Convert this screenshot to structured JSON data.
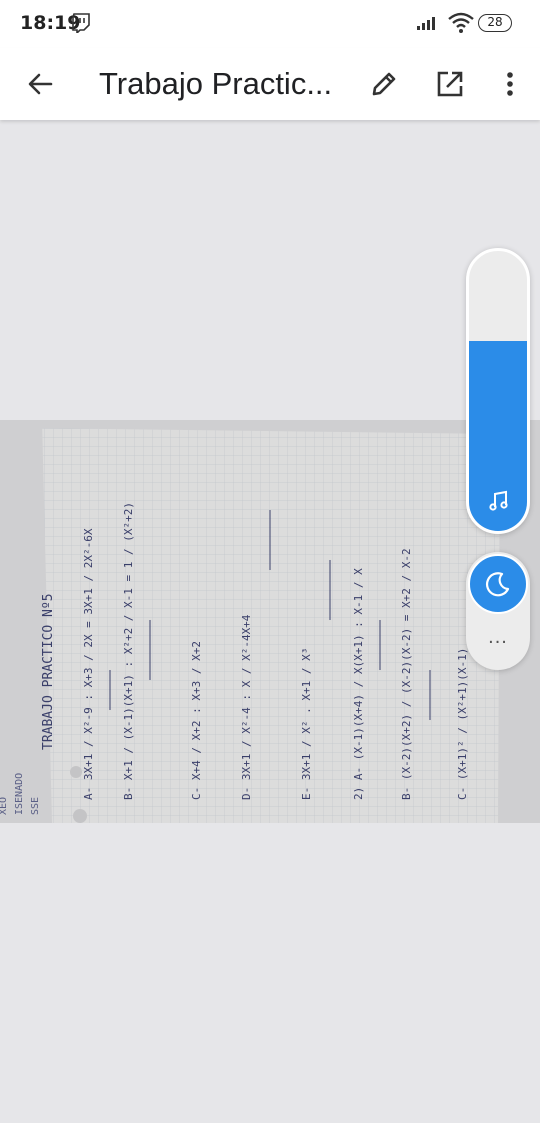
{
  "status_bar": {
    "time": "18:19",
    "battery": "28",
    "icons": [
      "twitch-icon",
      "signal-icon",
      "wifi-icon",
      "battery-icon"
    ]
  },
  "app_bar": {
    "title": "Trabajo Practic...",
    "icons": [
      "back-arrow-icon",
      "pencil-icon",
      "open-in-new-icon",
      "more-vert-icon"
    ]
  },
  "document": {
    "heading": "TRABAJO PRACTICO Nº5",
    "lines": [
      "A- 3X+1 / X²-9 : X+3 / 2X = 3X+1 / 2X²-6X",
      "B- X+1 / (X-1)(X+1) : X²+2 / X-1 = 1 / (X²+2)",
      "C- X+4 / X+2 : X+3 / X+2",
      "D- 3X+1 / X²-4 : X / X²-4X+4",
      "E- 3X+1 / X² . X+1 / X³",
      "2) A- (X-1)(X+4) / X(X+1) : X-1 / X",
      "B- (X-2)(X+2) / (X-2)(X-2) = X+2 / X-2",
      "C- (X+1)² / (X²+1)(X-1)"
    ],
    "margin_notes": [
      "XEO",
      "ISENADO",
      "SSE"
    ],
    "colors": {
      "paper": "#dcdcdc",
      "ink": "#3a3f6a",
      "grid": "#c2c6cc"
    }
  },
  "overlay": {
    "volume_level_percent": 68,
    "accent": "#2b8ce8",
    "icons": [
      "music-note-icon",
      "moon-icon",
      "more-horiz-icon"
    ],
    "more_label": "..."
  }
}
